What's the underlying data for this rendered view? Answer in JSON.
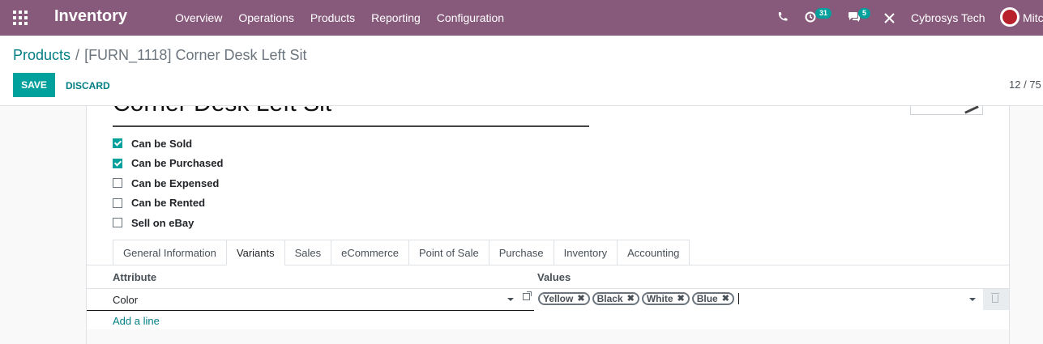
{
  "navbar": {
    "app_title": "Inventory",
    "menu": [
      "Overview",
      "Operations",
      "Products",
      "Reporting",
      "Configuration"
    ],
    "activity_count": "31",
    "message_count": "5",
    "company": "Cybrosys Tech",
    "user": "Mitc",
    "accent": "#875a7b"
  },
  "breadcrumb": {
    "parent": "Products",
    "current": "[FURN_1118] Corner Desk Left Sit"
  },
  "toolbar": {
    "save_label": "SAVE",
    "discard_label": "DISCARD",
    "pager": "12 / 75"
  },
  "product": {
    "name": "Corner Desk Left Sit",
    "options": [
      {
        "label": "Can be Sold",
        "checked": true
      },
      {
        "label": "Can be Purchased",
        "checked": true
      },
      {
        "label": "Can be Expensed",
        "checked": false
      },
      {
        "label": "Can be Rented",
        "checked": false
      },
      {
        "label": "Sell on eBay",
        "checked": false
      }
    ]
  },
  "tabs": [
    "General Information",
    "Variants",
    "Sales",
    "eCommerce",
    "Point of Sale",
    "Purchase",
    "Inventory",
    "Accounting"
  ],
  "active_tab": "Variants",
  "variants": {
    "columns": {
      "attribute": "Attribute",
      "values": "Values"
    },
    "rows": [
      {
        "attribute": "Color",
        "values": [
          "Yellow",
          "Black",
          "White",
          "Blue"
        ]
      }
    ],
    "add_line": "Add a line"
  }
}
